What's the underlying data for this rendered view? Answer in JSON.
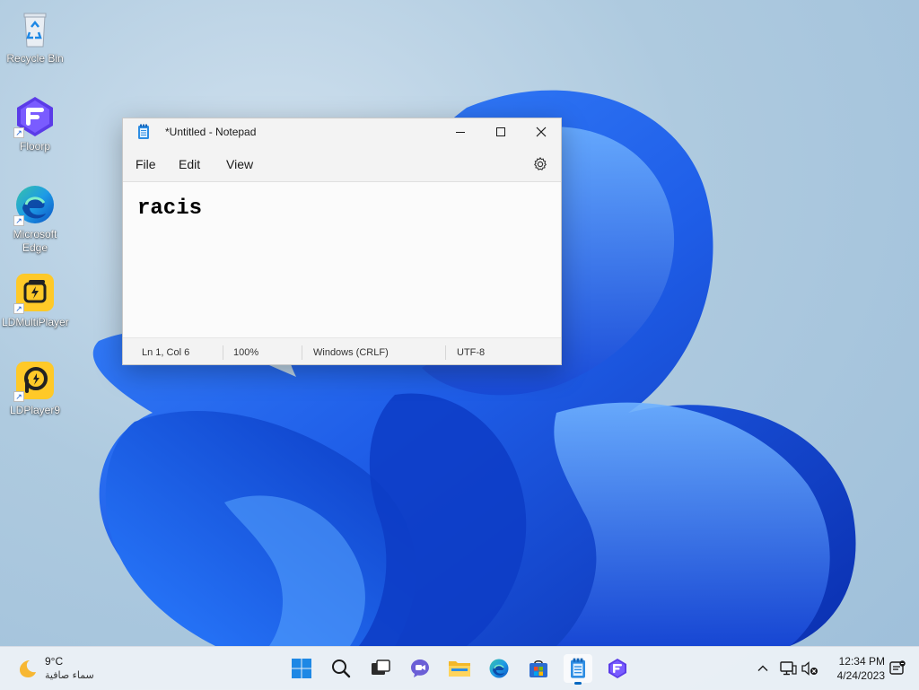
{
  "desktop": {
    "icons": [
      {
        "label": "Recycle Bin",
        "icon": "recycle-bin-icon"
      },
      {
        "label": "Floorp",
        "icon": "floorp-icon"
      },
      {
        "label": "Microsoft Edge",
        "icon": "edge-icon"
      },
      {
        "label": "LDMultiPlayer",
        "icon": "ldmultiplayer-icon"
      },
      {
        "label": "LDPlayer9",
        "icon": "ldplayer-icon"
      }
    ]
  },
  "notepad": {
    "title": "*Untitled - Notepad",
    "menu": {
      "file": "File",
      "edit": "Edit",
      "view": "View"
    },
    "content": "racis",
    "status": {
      "position": "Ln 1, Col 6",
      "zoom": "100%",
      "line_ending": "Windows (CRLF)",
      "encoding": "UTF-8"
    }
  },
  "taskbar": {
    "weather": {
      "temp": "9°C",
      "condition": "سماء صافية"
    },
    "apps": [
      "start-icon",
      "search-icon",
      "task-view-icon",
      "chat-icon",
      "file-explorer-icon",
      "edge-icon",
      "store-icon",
      "notepad-icon",
      "floorp-icon"
    ],
    "clock": {
      "time": "12:34 PM",
      "date": "4/24/2023"
    }
  },
  "colors": {
    "accent": "#0067c0",
    "wallpaper_blue": "#1f5ee8"
  }
}
